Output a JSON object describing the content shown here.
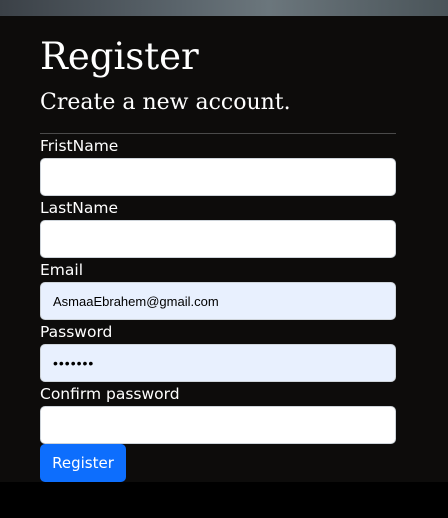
{
  "page": {
    "title": "Register",
    "subtitle": "Create a new account."
  },
  "form": {
    "first_name": {
      "label": "FristName",
      "value": ""
    },
    "last_name": {
      "label": "LastName",
      "value": ""
    },
    "email": {
      "label": "Email",
      "value": "AsmaaEbrahem@gmail.com"
    },
    "password": {
      "label": "Password",
      "value": "•••••••"
    },
    "confirm_password": {
      "label": "Confirm password",
      "value": ""
    },
    "submit_label": "Register"
  },
  "colors": {
    "background": "#0d0c0b",
    "primary_button": "#0d6efd",
    "autofill_field": "#e8f0fe"
  }
}
